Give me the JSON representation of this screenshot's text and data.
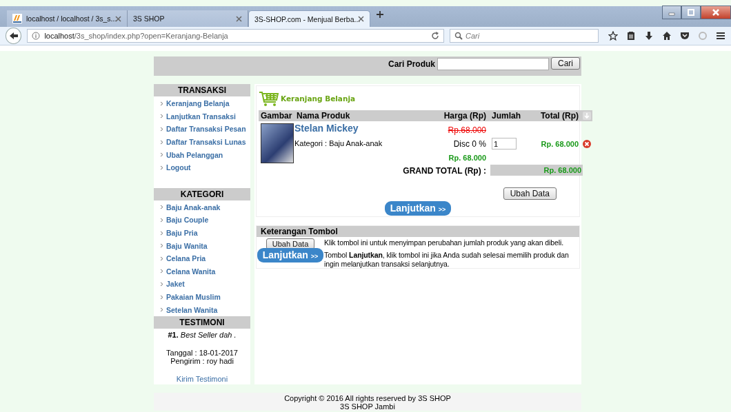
{
  "browser": {
    "tabs": [
      {
        "title": "localhost / localhost / 3s_s...",
        "selected": false,
        "kind": "app"
      },
      {
        "title": "3S SHOP",
        "selected": false,
        "kind": "plain"
      },
      {
        "title": "3S-SHOP.com - Menjual Berba...",
        "selected": true,
        "kind": "plain"
      }
    ],
    "url_host": "localhost",
    "url_path": "/3s_shop/index.php?open=Keranjang-Belanja",
    "search_placeholder": "Cari"
  },
  "search": {
    "label": "Cari Produk",
    "button": "Cari"
  },
  "sidebar": {
    "sections": [
      {
        "title": "TRANSAKSI",
        "items": [
          "Keranjang Belanja",
          "Lanjutkan Transaksi",
          "Daftar Transaksi Pesan",
          "Daftar Transaksi Lunas",
          "Ubah Pelanggan",
          "Logout"
        ]
      },
      {
        "title": "KATEGORI",
        "items": [
          "Baju Anak-anak",
          "Baju Couple",
          "Baju Pria",
          "Baju Wanita",
          "Celana Pria",
          "Celana Wanita",
          "Jaket",
          "Pakaian Muslim",
          "Setelan Wanita"
        ]
      }
    ],
    "testimoni": {
      "title": "TESTIMONI",
      "number": "#1.",
      "text": "Best Seller dah .",
      "date": "Tanggal : 18-01-2017",
      "sender": "Pengirim : roy hadi",
      "link": "Kirim Testimoni"
    }
  },
  "cart": {
    "title": "Keranjang Belanja",
    "columns": [
      "Gambar",
      "Nama Produk",
      "Harga (Rp)",
      "Jumlah",
      "Total (Rp)"
    ],
    "items": [
      {
        "name": "Stelan Mickey",
        "category": "Kategori : Baju Anak-anak",
        "old_price": "Rp.68.000",
        "discount": "Disc 0 %",
        "price": "Rp. 68.000",
        "quantity": "1",
        "total": "Rp. 68.000"
      }
    ],
    "grand_total_label": "GRAND TOTAL (Rp) :",
    "grand_total": "Rp. 68.000",
    "update_button": "Ubah Data",
    "continue_button": "Lanjutkan",
    "continue_arrow": ">>"
  },
  "help": {
    "title": "Keterangan Tombol",
    "rows": [
      {
        "kind": "plain",
        "button": "Ubah Data",
        "text": "Klik tombol ini untuk menyimpan perubahan jumlah produk yang akan dibeli."
      },
      {
        "kind": "primary",
        "button": "Lanjutkan",
        "arrow": ">>",
        "text": "Tombol **Lanjutkan**, klik tombol ini jika Anda sudah selesai memilih produk dan ingin melanjutkan transaksi selanjutnya."
      }
    ]
  },
  "footer": {
    "lines": [
      "Copyright © 2016 All rights reserved by 3S SHOP",
      "3S SHOP Jambi"
    ]
  }
}
